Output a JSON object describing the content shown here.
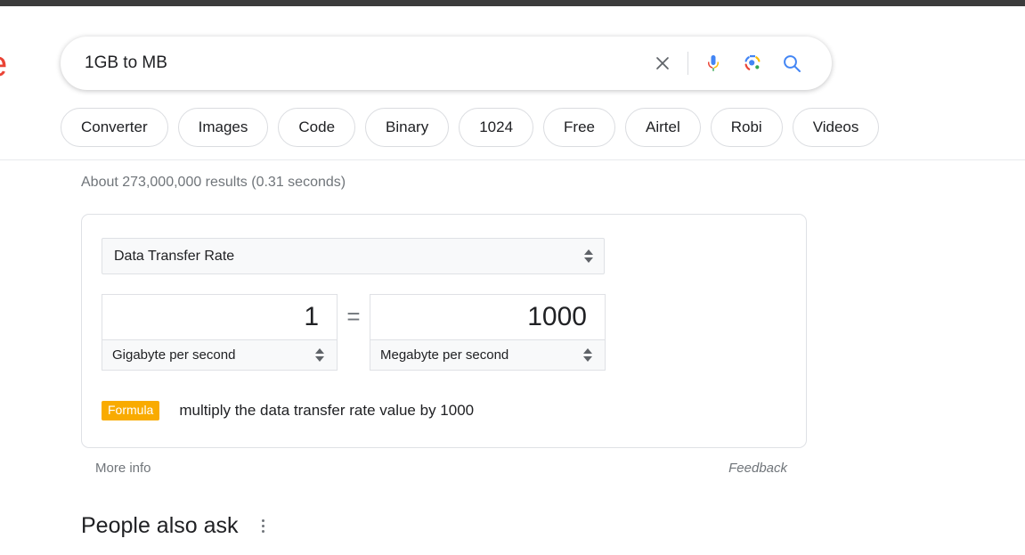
{
  "browser": {
    "top_bar_color": "#3c3c3c"
  },
  "header": {
    "logo_fragment": "e",
    "search": {
      "value": "1GB to MB",
      "placeholder": "Search",
      "clear_icon": "close-icon",
      "voice_icon": "microphone-icon",
      "lens_icon": "google-lens-icon",
      "search_icon": "search-icon"
    },
    "chips": [
      {
        "label": "Converter"
      },
      {
        "label": "Images"
      },
      {
        "label": "Code"
      },
      {
        "label": "Binary"
      },
      {
        "label": "1024"
      },
      {
        "label": "Free"
      },
      {
        "label": "Airtel"
      },
      {
        "label": "Robi"
      },
      {
        "label": "Videos"
      }
    ]
  },
  "results": {
    "stats": "About 273,000,000 results (0.31 seconds)",
    "converter": {
      "category": "Data Transfer Rate",
      "left": {
        "value": "1",
        "unit": "Gigabyte per second"
      },
      "equals_symbol": "=",
      "right": {
        "value": "1000",
        "unit": "Megabyte per second"
      },
      "formula_badge": "Formula",
      "formula_text": "multiply the data transfer rate value by 1000",
      "more_info": "More info",
      "feedback": "Feedback"
    },
    "people_also_ask": {
      "title": "People also ask",
      "menu_icon": "kebab-menu-icon"
    }
  },
  "colors": {
    "google_red": "#ea4335",
    "google_blue": "#4285f4",
    "google_yellow": "#fbbc05",
    "google_green": "#34a853",
    "formula_amber": "#f9ab00",
    "text_primary": "#202124",
    "text_secondary": "#70757a",
    "border": "#dfe1e5"
  }
}
